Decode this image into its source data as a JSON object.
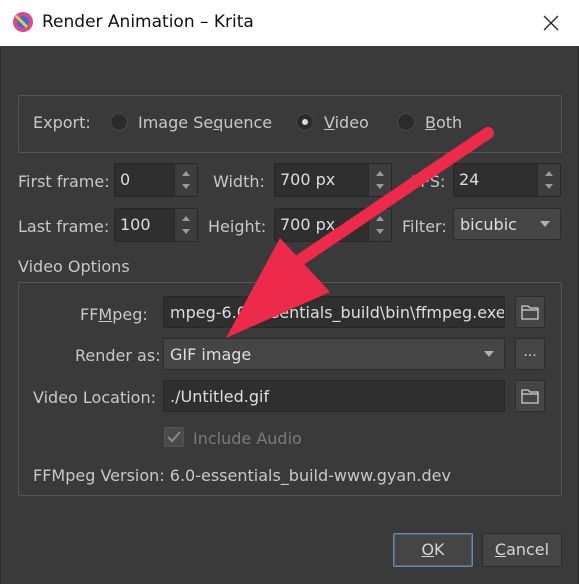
{
  "window": {
    "title": "Render Animation – Krita",
    "icon": "krita-app-icon",
    "close_icon": "close-icon"
  },
  "export": {
    "label": "Export:",
    "options": [
      {
        "label_pre": "Image Se",
        "label_u": "q",
        "label_post": "uence",
        "selected": false
      },
      {
        "label_pre": "",
        "label_u": "V",
        "label_post": "ideo",
        "selected": true
      },
      {
        "label_pre": "",
        "label_u": "B",
        "label_post": "oth",
        "selected": false
      }
    ]
  },
  "frames": {
    "first_label": "First frame:",
    "first_value": "0",
    "last_label": "Last frame:",
    "last_value": "100",
    "width_label": "Width:",
    "width_value": "700 px",
    "height_label": "Height:",
    "height_value": "700 px",
    "fps_label": "FPS:",
    "fps_value": "24",
    "filter_label": "Filter:",
    "filter_value": "bicubic"
  },
  "video_options": {
    "heading": "Video Options",
    "ffmpeg_label_pre": "FF",
    "ffmpeg_label_u": "M",
    "ffmpeg_label_post": "peg:",
    "ffmpeg_path": "mpeg-6.0-essentials_build\\bin\\ffmpeg.exe",
    "render_as_label": "Render as:",
    "render_as_value": "GIF image",
    "more_label": "...",
    "location_label": "Video Location:",
    "location_value": "./Untitled.gif",
    "include_audio_label": "Include Audio",
    "include_audio_checked": true,
    "version_text": "FFMpeg Version: 6.0-essentials_build-www.gyan.dev"
  },
  "buttons": {
    "ok_u": "O",
    "ok_post": "K",
    "cancel_u": "C",
    "cancel_post": "ancel"
  },
  "colors": {
    "annotation_arrow": "#ee2a4a",
    "dialog_bg": "#3a3a3a",
    "default_button_border": "#6b88a8"
  }
}
